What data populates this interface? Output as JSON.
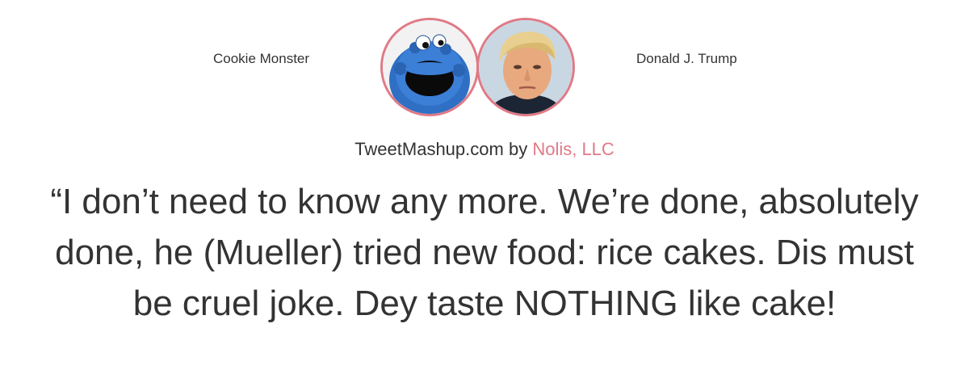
{
  "authors": {
    "left": {
      "name": "Cookie Monster",
      "avatar_icon": "cookie-monster-avatar",
      "border_color": "#e07a86"
    },
    "right": {
      "name": "Donald J. Trump",
      "avatar_icon": "donald-trump-avatar",
      "border_color": "#e07a86"
    }
  },
  "attribution": {
    "site": "TweetMashup.com",
    "by": "by",
    "company": "Nolis, LLC",
    "link_color": "#e07a86"
  },
  "quote": {
    "text": "“I don’t need to know any more. We’re done, absolutely done, he (Mueller) tried new food: rice cakes. Dis must be cruel joke. Dey taste NOTHING like cake!"
  }
}
